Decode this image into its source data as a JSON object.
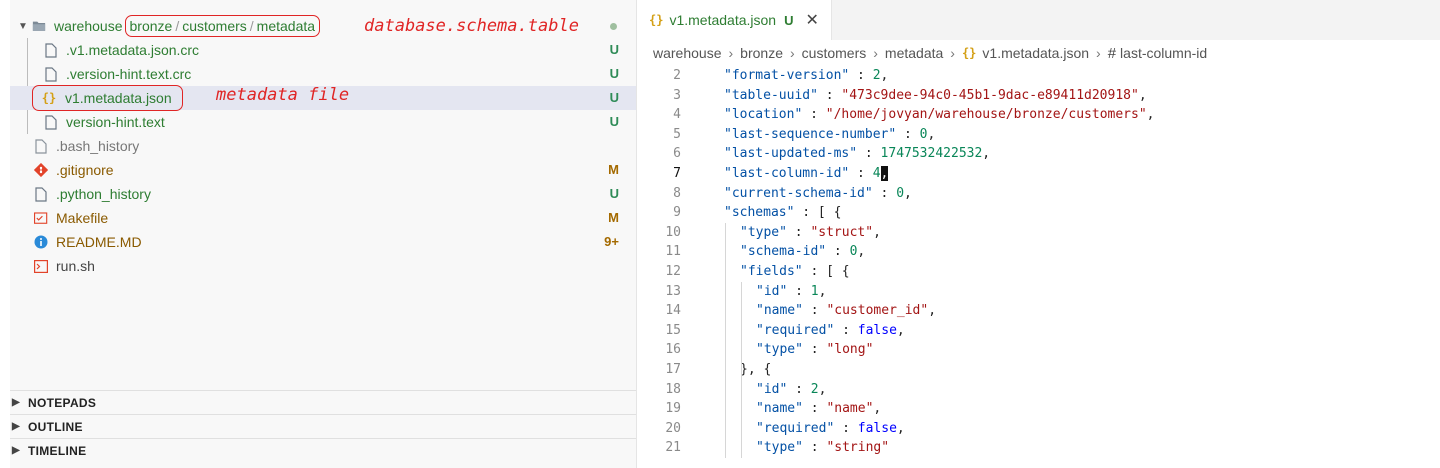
{
  "explorer": {
    "folder": {
      "name": "warehouse",
      "path": [
        "bronze",
        "customers",
        "metadata"
      ],
      "annotation": "database.schema.table"
    },
    "children": [
      {
        "name": ".v1.metadata.json.crc",
        "status": "U"
      },
      {
        "name": ".version-hint.text.crc",
        "status": "U"
      },
      {
        "name": "v1.metadata.json",
        "status": "U",
        "annotation": "metadata file"
      },
      {
        "name": "version-hint.text",
        "status": "U"
      }
    ],
    "files": [
      {
        "name": ".bash_history",
        "status": ""
      },
      {
        "name": ".gitignore",
        "status": "M"
      },
      {
        "name": ".python_history",
        "status": "U"
      },
      {
        "name": "Makefile",
        "status": "M"
      },
      {
        "name": "README.MD",
        "status": "9+"
      },
      {
        "name": "run.sh",
        "status": ""
      }
    ],
    "panels": [
      "NOTEPADS",
      "OUTLINE",
      "TIMELINE"
    ]
  },
  "editor": {
    "tab": {
      "title": "v1.metadata.json",
      "status": "U"
    },
    "breadcrumbs": [
      "warehouse",
      "bronze",
      "customers",
      "metadata",
      "v1.metadata.json",
      "last-column-id"
    ],
    "lines": [
      {
        "n": "2",
        "t": "\"format-version\" : 2,"
      },
      {
        "n": "3",
        "t": "\"table-uuid\" : \"473c9dee-94c0-45b1-9dac-e89411d20918\","
      },
      {
        "n": "4",
        "t": "\"location\" : \"/home/jovyan/warehouse/bronze/customers\","
      },
      {
        "n": "5",
        "t": "\"last-sequence-number\" : 0,"
      },
      {
        "n": "6",
        "t": "\"last-updated-ms\" : 1747532422532,"
      },
      {
        "n": "7",
        "t": "\"last-column-id\" : 4,"
      },
      {
        "n": "8",
        "t": "\"current-schema-id\" : 0,"
      },
      {
        "n": "9",
        "t": "\"schemas\" : [ {"
      },
      {
        "n": "10",
        "t": "\"type\" : \"struct\","
      },
      {
        "n": "11",
        "t": "\"schema-id\" : 0,"
      },
      {
        "n": "12",
        "t": "\"fields\" : [ {"
      },
      {
        "n": "13",
        "t": "\"id\" : 1,"
      },
      {
        "n": "14",
        "t": "\"name\" : \"customer_id\","
      },
      {
        "n": "15",
        "t": "\"required\" : false,"
      },
      {
        "n": "16",
        "t": "\"type\" : \"long\""
      },
      {
        "n": "17",
        "t": "}, {"
      },
      {
        "n": "18",
        "t": "\"id\" : 2,"
      },
      {
        "n": "19",
        "t": "\"name\" : \"name\","
      },
      {
        "n": "20",
        "t": "\"required\" : false,"
      },
      {
        "n": "21",
        "t": "\"type\" : \"string\""
      }
    ],
    "active_line": "7"
  },
  "colors": {
    "untracked": "#2e7d32",
    "modified": "#8a5a00",
    "annotation": "#e02525",
    "json_key": "#0451a5",
    "json_string": "#a31515",
    "json_number": "#098658",
    "json_bool": "#0000ff"
  }
}
